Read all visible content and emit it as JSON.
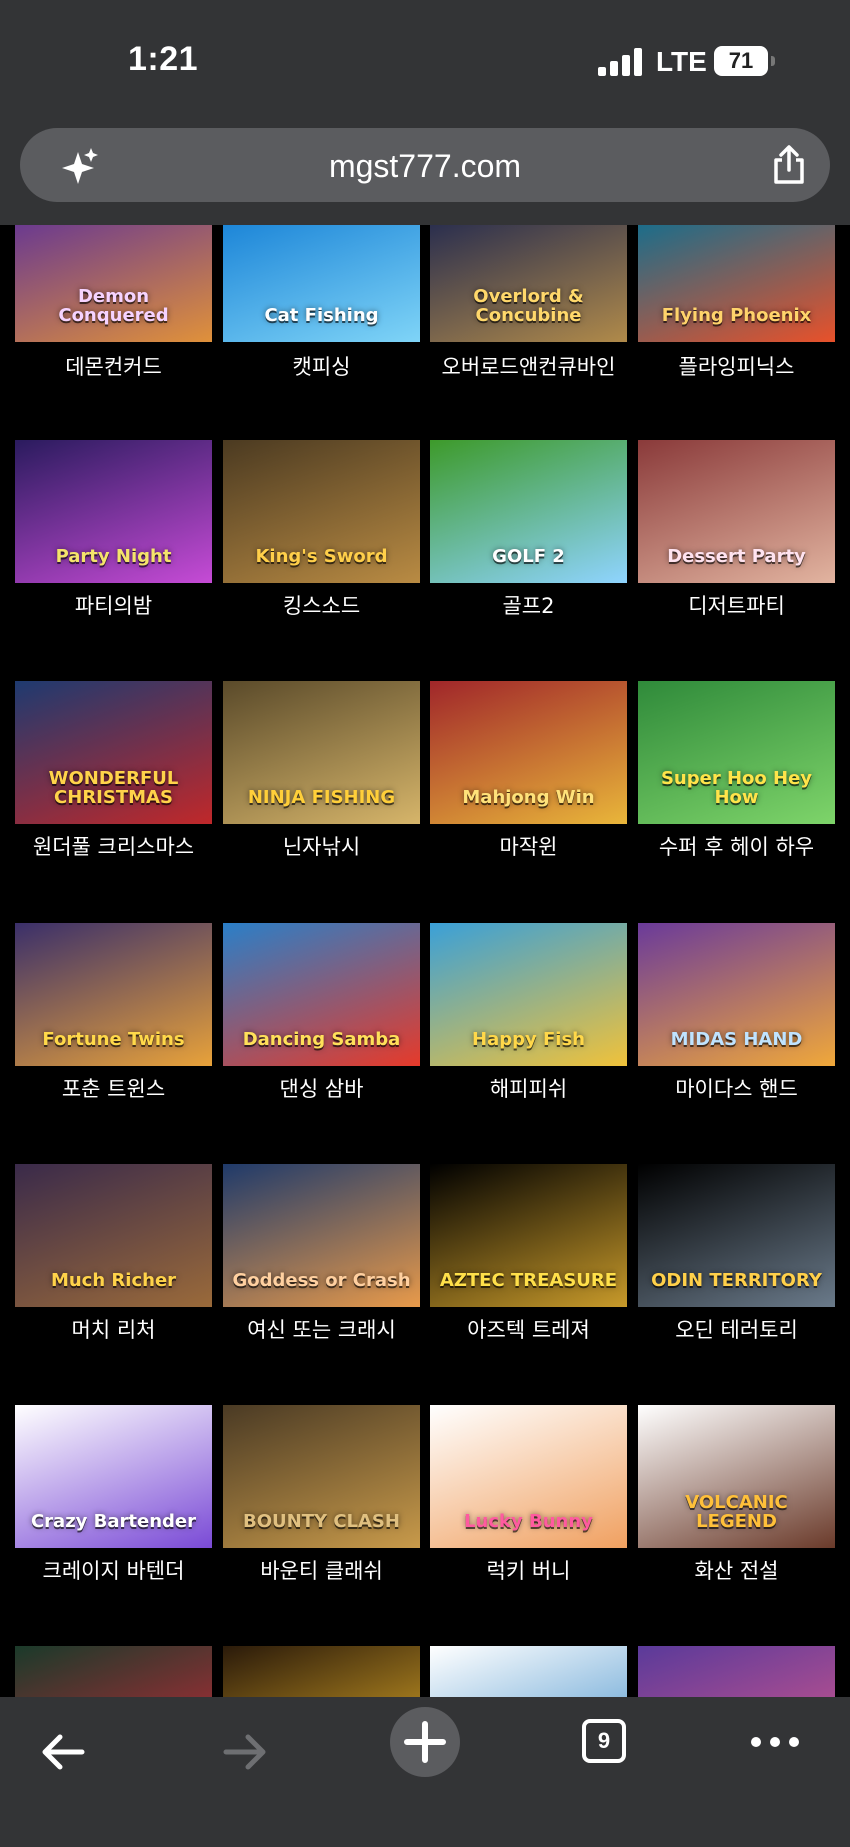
{
  "status": {
    "time": "1:21",
    "network": "LTE",
    "battery": "71"
  },
  "browser": {
    "url": "mgst777.com",
    "tab_count": "9"
  },
  "games": [
    {
      "label": "데몬컨커드",
      "logo": "Demon Conquered",
      "bg": "#6b3a8f",
      "bg2": "#e0913a",
      "logo_color": "#f6d3ff"
    },
    {
      "label": "캣피싱",
      "logo": "Cat Fishing",
      "bg": "#1d86d8",
      "bg2": "#7fd4f7",
      "logo_color": "#ffffff"
    },
    {
      "label": "오버로드앤컨큐바인",
      "logo": "Overlord & Concubine",
      "bg": "#2b2f4e",
      "bg2": "#b08a4a",
      "logo_color": "#ffd86b"
    },
    {
      "label": "플라잉피닉스",
      "logo": "Flying Phoenix",
      "bg": "#1c6d8a",
      "bg2": "#e8512a",
      "logo_color": "#ffd36b"
    },
    {
      "label": "파티의밤",
      "logo": "Party Night",
      "bg": "#2a1b5e",
      "bg2": "#c64bd6",
      "logo_color": "#f4e46b"
    },
    {
      "label": "킹스소드",
      "logo": "King's Sword",
      "bg": "#4b3a21",
      "bg2": "#b98b43",
      "logo_color": "#ffcf4a"
    },
    {
      "label": "골프2",
      "logo": "GOLF 2",
      "bg": "#3d9a2a",
      "bg2": "#8fd4ff",
      "logo_color": "#ffffff"
    },
    {
      "label": "디저트파티",
      "logo": "Dessert Party",
      "bg": "#8a3a3a",
      "bg2": "#e2b4a0",
      "logo_color": "#ffe3f0"
    },
    {
      "label": "원더풀 크리스마스",
      "logo": "WONDERFUL CHRISTMAS",
      "bg": "#1e3a70",
      "bg2": "#c0282a",
      "logo_color": "#ffd34a"
    },
    {
      "label": "닌자낚시",
      "logo": "NINJA FISHING",
      "bg": "#5a4a2a",
      "bg2": "#d6b56a",
      "logo_color": "#ffcf3a"
    },
    {
      "label": "마작윈",
      "logo": "Mahjong Win",
      "bg": "#a0262a",
      "bg2": "#e9b63a",
      "logo_color": "#ffe27a"
    },
    {
      "label": "수퍼 후 헤이 하우",
      "logo": "Super Hoo Hey How",
      "bg": "#2f8a3a",
      "bg2": "#7ed46a",
      "logo_color": "#ffe44a"
    },
    {
      "label": "포춘 트윈스",
      "logo": "Fortune Twins",
      "bg": "#3a2f6a",
      "bg2": "#e8a23a",
      "logo_color": "#ffd94a"
    },
    {
      "label": "댄싱 삼바",
      "logo": "Dancing Samba",
      "bg": "#2a7fc8",
      "bg2": "#e63a2a",
      "logo_color": "#ffe05a"
    },
    {
      "label": "해피피쉬",
      "logo": "Happy Fish",
      "bg": "#3aa0d8",
      "bg2": "#f0c23a",
      "logo_color": "#ffd84a"
    },
    {
      "label": "마이다스 핸드",
      "logo": "MIDAS HAND",
      "bg": "#6a3a9a",
      "bg2": "#f0a83a",
      "logo_color": "#bfe3ff"
    },
    {
      "label": "머치 리처",
      "logo": "Much Richer",
      "bg": "#3a2a4a",
      "bg2": "#9a6a3a",
      "logo_color": "#ffd34a"
    },
    {
      "label": "여신 또는 크래시",
      "logo": "Goddess or Crash",
      "bg": "#1f3a6a",
      "bg2": "#e89a4a",
      "logo_color": "#ffd0a0"
    },
    {
      "label": "아즈텍 트레져",
      "logo": "AZTEC TREASURE",
      "bg": "#000000",
      "bg2": "#c89a2a",
      "logo_color": "#ffe04a"
    },
    {
      "label": "오딘 테러토리",
      "logo": "ODIN TERRITORY",
      "bg": "#000000",
      "bg2": "#6a7a8a",
      "logo_color": "#ffd04a"
    },
    {
      "label": "크레이지 바텐더",
      "logo": "Crazy Bartender",
      "bg": "#ffffff",
      "bg2": "#7a4ad6",
      "logo_color": "#ffffff"
    },
    {
      "label": "바운티 클래쉬",
      "logo": "BOUNTY CLASH",
      "bg": "#4a3a24",
      "bg2": "#c89a4a",
      "logo_color": "#e0c080"
    },
    {
      "label": "럭키 버니",
      "logo": "Lucky Bunny",
      "bg": "#ffffff",
      "bg2": "#f0a060",
      "logo_color": "#ff5aa0"
    },
    {
      "label": "화산 전설",
      "logo": "VOLCANIC LEGEND",
      "bg": "#ffffff",
      "bg2": "#6a3a2a",
      "logo_color": "#ffc03a"
    },
    {
      "label": "",
      "logo": "",
      "bg": "#1a3a2a",
      "bg2": "#d6283a",
      "logo_color": "#ffffff"
    },
    {
      "label": "",
      "logo": "",
      "bg": "#2a1a0a",
      "bg2": "#f0b82a",
      "logo_color": "#ffffff"
    },
    {
      "label": "",
      "logo": "",
      "bg": "#ffffff",
      "bg2": "#3a8ac8",
      "logo_color": "#ffffff"
    },
    {
      "label": "",
      "logo": "",
      "bg": "#5a3a9a",
      "bg2": "#e05a8a",
      "logo_color": "#ffffff"
    }
  ]
}
